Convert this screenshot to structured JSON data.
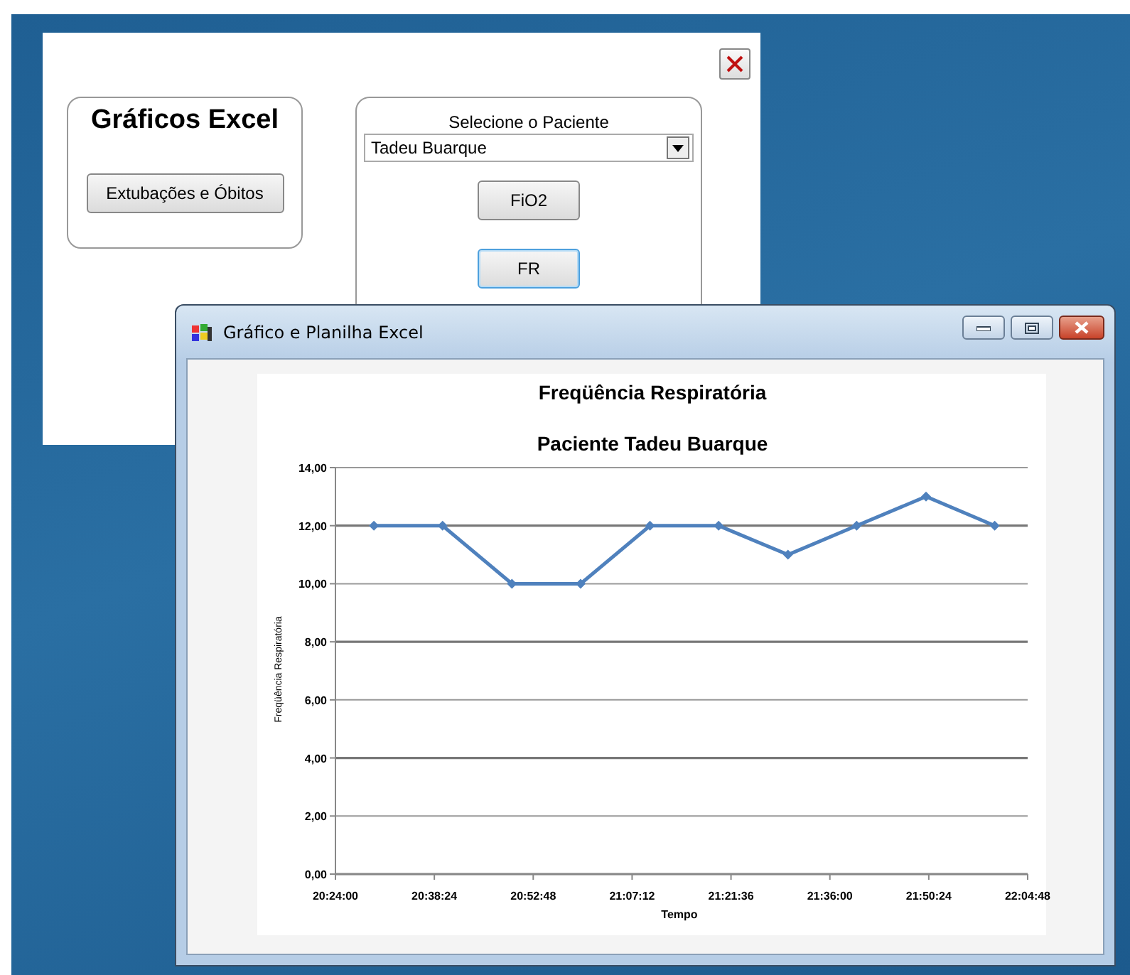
{
  "dialog": {
    "excel_group": {
      "title": "Gráficos Excel",
      "buttons": [
        "Extubações e Óbitos"
      ]
    },
    "patient_group": {
      "label": "Selecione o Paciente",
      "patient": "Tadeu Buarque",
      "buttons": [
        {
          "label": "FiO2",
          "focused": false
        },
        {
          "label": "FR",
          "focused": true
        }
      ]
    }
  },
  "chart_window": {
    "title": "Gráfico e Planilha Excel",
    "chart": {
      "subtitle": "Paciente Tadeu Buarque",
      "chart_data": {
        "type": "line",
        "title": "Freqüência Respiratória",
        "xlabel": "Tempo",
        "ylabel": "Freqüência Respiratória",
        "x": [
          1229.6,
          1239.6,
          1249.7,
          1259.7,
          1269.8,
          1279.8,
          1289.9,
          1299.9,
          1310.0,
          1320.0
        ],
        "grid": true,
        "series": [
          {
            "color": "#4f81bd",
            "marker": "diamond",
            "values": [
              12,
              12,
              10,
              10,
              12,
              12,
              11,
              12,
              13,
              12
            ]
          }
        ],
        "xlim": [
          1224,
          1324.8
        ],
        "ylim": [
          0,
          14
        ],
        "xticks": [
          {
            "value": 1224,
            "label": "20:24:00"
          },
          {
            "value": 1238.4,
            "label": "20:38:24"
          },
          {
            "value": 1252.8,
            "label": "20:52:48"
          },
          {
            "value": 1267.2,
            "label": "21:07:12"
          },
          {
            "value": 1281.6,
            "label": "21:21:36"
          },
          {
            "value": 1296,
            "label": "21:36:00"
          },
          {
            "value": 1310.4,
            "label": "21:50:24"
          },
          {
            "value": 1324.8,
            "label": "22:04:48"
          }
        ],
        "yticks": [
          {
            "value": 0,
            "label": "0,00"
          },
          {
            "value": 2,
            "label": "2,00"
          },
          {
            "value": 4,
            "label": "4,00"
          },
          {
            "value": 6,
            "label": "6,00"
          },
          {
            "value": 8,
            "label": "8,00"
          },
          {
            "value": 10,
            "label": "10,00"
          },
          {
            "value": 12,
            "label": "12,00"
          },
          {
            "value": 14,
            "label": "14,00"
          }
        ]
      }
    }
  }
}
